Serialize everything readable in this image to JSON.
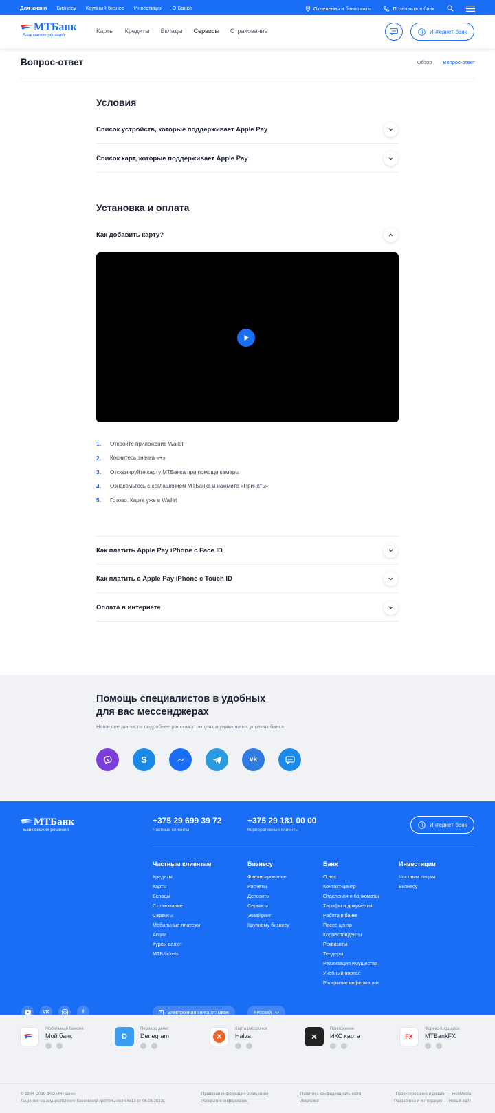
{
  "topbar": {
    "links": [
      "Для жизни",
      "Бизнесу",
      "Крупный бизнес",
      "Инвестиции",
      "О Банке"
    ],
    "offices": "Отделения и банкоматы",
    "call": "Позвонить в банк"
  },
  "header": {
    "logo_name": "МТБанк",
    "logo_tagline": "Банк свежих решений",
    "nav": [
      "Карты",
      "Кредиты",
      "Вклады",
      "Сервисы",
      "Страхование"
    ],
    "active_nav": "Сервисы",
    "internet_bank": "Интернет-банк"
  },
  "page": {
    "title": "Вопрос-ответ",
    "crumbs": [
      "Обзор",
      "Вопрос-ответ"
    ]
  },
  "faq": {
    "section1_title": "Условия",
    "section1_items": [
      "Список устройств, которые поддерживает Apple Pay",
      "Список карт, которые поддерживает Apple Pay"
    ],
    "section2_title": "Установка и оплата",
    "open_item": "Как добавить карту?",
    "steps": [
      {
        "n": "1.",
        "text": "Откройте приложение Wallet"
      },
      {
        "n": "2.",
        "text": "Коснитесь значка «+»"
      },
      {
        "n": "3.",
        "text": "Отсканируйте карту МТБанка при помощи камеры"
      },
      {
        "n": "4.",
        "text": "Ознакомьтесь с соглашением МТБанка и нажмите «Принять»"
      },
      {
        "n": "5.",
        "text": "Готово. Карта уже в Wallet"
      }
    ],
    "section2_items": [
      "Как платить Apple Pay iPhone с Face ID",
      "Как платить с Apple Pay iPhone с Touch ID",
      "Оплата в интернете"
    ]
  },
  "help": {
    "title_line1": "Помощь специалистов в удобных",
    "title_line2": "для вас мессенджерах",
    "subtitle": "Наши специалисты подробнее расскажут акциях и уникальных уловиях банка.",
    "messengers": [
      {
        "name": "viper-icon",
        "color": "#7b3fd8"
      },
      {
        "name": "skype-icon",
        "color": "#1a8ae8"
      },
      {
        "name": "messenger-icon",
        "color": "#1a6df5"
      },
      {
        "name": "telegram-icon",
        "color": "#2a9be0"
      },
      {
        "name": "vk-icon",
        "color": "#2f7be0"
      },
      {
        "name": "chat-icon",
        "color": "#1a8ae8"
      }
    ]
  },
  "footer": {
    "logo_name": "МТБанк",
    "logo_tagline": "Банк свежих решений",
    "phone1": "+375 29 699 39 72",
    "phone1_label": "Частные клиенты",
    "phone2": "+375 29 181 00 00",
    "phone2_label": "Корпоративные клиенты",
    "internet_bank": "Интернет-банк",
    "columns": [
      {
        "title": "Частным клиентам",
        "items": [
          "Кредиты",
          "Карты",
          "Вклады",
          "Страхование",
          "Сервисы",
          "Мобильные платежи",
          "Акции",
          "Курсы валют",
          "MTB.tickets"
        ]
      },
      {
        "title": "Бизнесу",
        "items": [
          "Финансирование",
          "Расчёты",
          "Депозиты",
          "Сервисы",
          "Эквайринг",
          "Крупному бизнесу"
        ]
      },
      {
        "title": "Банк",
        "items": [
          "О нас",
          "Контакт-центр",
          "Отделения и банкоматы",
          "Тарифы и документы",
          "Работа в банке",
          "Пресс-центр",
          "Корреспонденты",
          "Реквизиты",
          "Тендеры",
          "Реализация имущества",
          "Учебный портал",
          "Раскрытие информации"
        ]
      },
      {
        "title": "Инвестиции",
        "items": [
          "Частным лицам",
          "Бизнесу"
        ]
      }
    ],
    "social": [
      "YT",
      "VK",
      "IG",
      "f"
    ],
    "feedback": "Электронная книга отзывов",
    "language": "Русский"
  },
  "apps": [
    {
      "sub": "Мобильный банкинг",
      "title": "Мой банк",
      "color": "#ffffff",
      "glyph": "М"
    },
    {
      "sub": "Перевод денег",
      "title": "Denegram",
      "color": "#3a9cf0",
      "glyph": "D"
    },
    {
      "sub": "Карта рассрочки",
      "title": "Halva",
      "color": "#f06428",
      "glyph": "✕"
    },
    {
      "sub": "Приложение",
      "title": "ИКС карта",
      "color": "#222222",
      "glyph": "✕"
    },
    {
      "sub": "Форекс-площадка",
      "title": "MTBankFX",
      "color": "#ffffff",
      "glyph": "FX"
    }
  ],
  "bottom": {
    "copyright": "© 1994–2019 ЗАО «МТБанк»",
    "license": "Лицензия на осуществление банковской деятельности №13 от 06.05.2013г.",
    "legal1": "Правовая информация о лицензии",
    "legal2": "Раскрытие информации",
    "policy1": "Политика конфиденциальности",
    "policy2": "Лицензия",
    "design": "Проектирование и дизайн — FlexMedia",
    "dev": "Разработка и интеграция — Новый сайт"
  }
}
